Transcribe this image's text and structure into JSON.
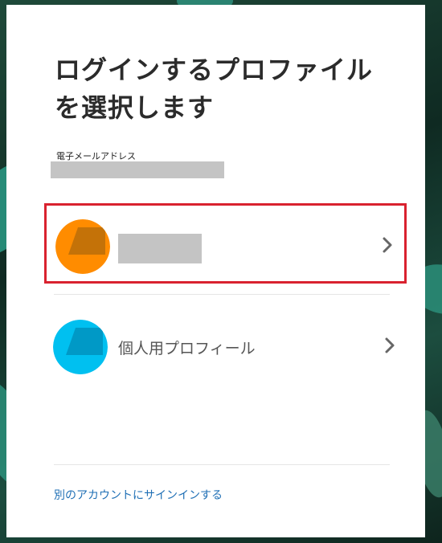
{
  "title": "ログインするプロファイルを選択します",
  "email_label": "電子メールアドレス",
  "profiles": [
    {
      "name": "",
      "avatar_color": "#ff8c00",
      "avatar_shape_color": "#c47208",
      "selected": true
    },
    {
      "name": "個人用プロフィール",
      "avatar_color": "#00c0f0",
      "avatar_shape_color": "#0099c6",
      "selected": false
    }
  ],
  "signin_other": "別のアカウントにサインインする",
  "colors": {
    "highlight": "#d9222f",
    "link": "#1f6fb5",
    "redaction": "#c4c4c4"
  }
}
